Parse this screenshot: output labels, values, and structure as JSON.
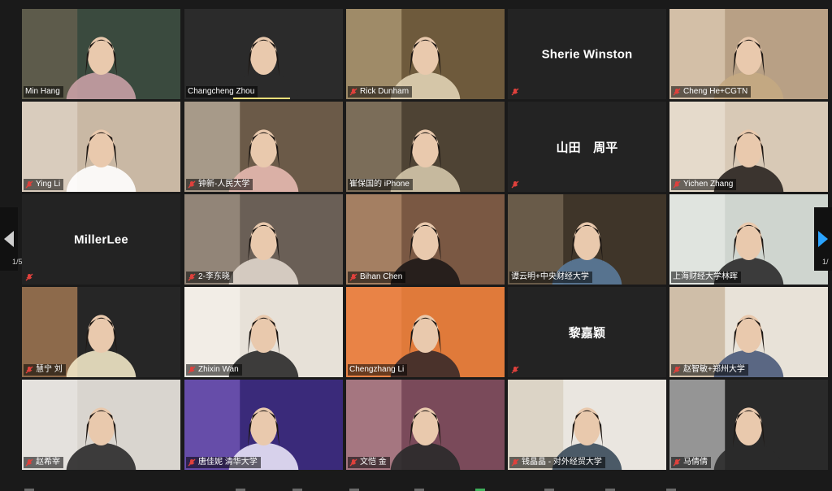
{
  "meeting": {
    "page_indicator_left": "1/5",
    "page_indicator_right": "1/"
  },
  "participants": [
    {
      "name": "Min Hang",
      "muted": false,
      "video": true
    },
    {
      "name": "Changcheng Zhou",
      "muted": false,
      "video": true
    },
    {
      "name": "Rick Dunham",
      "muted": true,
      "video": true
    },
    {
      "name": "",
      "display_name": "Sherie Winston",
      "muted": true,
      "video": false
    },
    {
      "name": "Cheng He+CGTN",
      "muted": true,
      "video": true
    },
    {
      "name": "Ying Li",
      "muted": true,
      "video": true
    },
    {
      "name": "钟新-人民大学",
      "muted": true,
      "video": true
    },
    {
      "name": "崔保国的 iPhone",
      "muted": false,
      "video": true
    },
    {
      "name": "",
      "display_name": "山田　周平",
      "muted": true,
      "video": false
    },
    {
      "name": "Yichen Zhang",
      "muted": true,
      "video": true
    },
    {
      "name": "",
      "display_name": "MillerLee",
      "muted": true,
      "video": false
    },
    {
      "name": "2-李东晓",
      "muted": true,
      "video": true
    },
    {
      "name": "Bihan Chen",
      "muted": true,
      "video": true
    },
    {
      "name": "谭云明+中央财经大学",
      "muted": false,
      "video": true
    },
    {
      "name": "上海财经大学林晖",
      "muted": false,
      "video": true
    },
    {
      "name": "慧宁 刘",
      "muted": true,
      "video": true
    },
    {
      "name": "Zhixin Wan",
      "muted": true,
      "video": true
    },
    {
      "name": "Chengzhang Li",
      "muted": false,
      "video": true,
      "active": true
    },
    {
      "name": "",
      "display_name": "黎嘉颖",
      "muted": true,
      "video": false
    },
    {
      "name": "赵智敏+郑州大学",
      "muted": true,
      "video": true
    },
    {
      "name": "赵希宰",
      "muted": true,
      "video": true
    },
    {
      "name": "唐佳妮 清华大学",
      "muted": true,
      "video": true
    },
    {
      "name": "文恺 金",
      "muted": true,
      "video": true
    },
    {
      "name": "钱晶晶 - 对外经贸大学",
      "muted": true,
      "video": true
    },
    {
      "name": "马倩倩",
      "muted": true,
      "video": true
    }
  ],
  "colors": {
    "mute_icon": "#e0413c",
    "active_border": "#a6d23a",
    "nav_arrow": "#d0d0d0",
    "nav_arrow_right": "#2aa3ff"
  }
}
